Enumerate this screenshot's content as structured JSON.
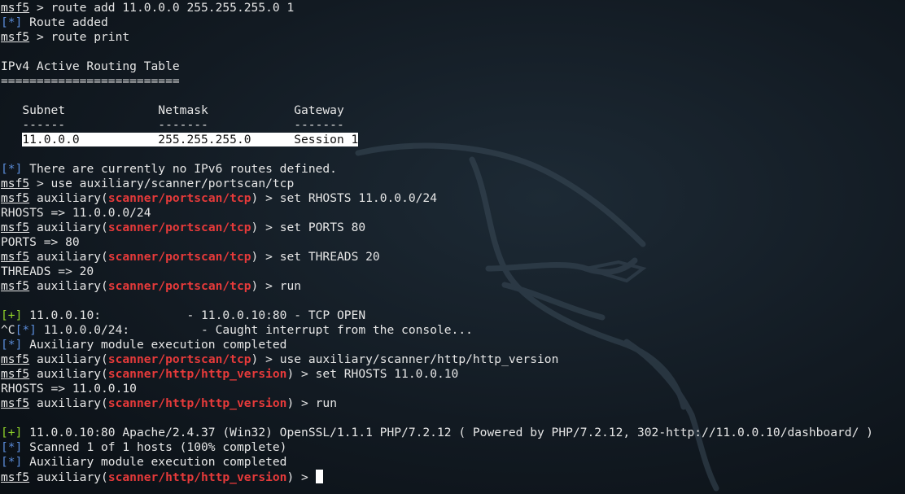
{
  "prompt": "msf5",
  "lines": [
    {
      "type": "cmd",
      "command": "route add 11.0.0.0 255.255.255.0 1"
    },
    {
      "type": "info",
      "marker": "[*]",
      "text": "Route added"
    },
    {
      "type": "cmd",
      "command": "route print"
    },
    {
      "type": "blank"
    },
    {
      "type": "text",
      "text": "IPv4 Active Routing Table"
    },
    {
      "type": "text",
      "text": "========================="
    },
    {
      "type": "blank"
    },
    {
      "type": "text",
      "text": "   Subnet             Netmask            Gateway"
    },
    {
      "type": "text",
      "text": "   ------             -------            -------"
    },
    {
      "type": "highlight",
      "prefix": "   ",
      "text": "11.0.0.0           255.255.255.0      Session 1"
    },
    {
      "type": "blank"
    },
    {
      "type": "info",
      "marker": "[*]",
      "text": "There are currently no IPv6 routes defined."
    },
    {
      "type": "cmd",
      "command": "use auxiliary/scanner/portscan/tcp"
    },
    {
      "type": "cmd",
      "module": "scanner/portscan/tcp",
      "command": "set RHOSTS 11.0.0.0/24"
    },
    {
      "type": "text",
      "text": "RHOSTS => 11.0.0.0/24"
    },
    {
      "type": "cmd",
      "module": "scanner/portscan/tcp",
      "command": "set PORTS 80"
    },
    {
      "type": "text",
      "text": "PORTS => 80"
    },
    {
      "type": "cmd",
      "module": "scanner/portscan/tcp",
      "command": "set THREADS 20"
    },
    {
      "type": "text",
      "text": "THREADS => 20"
    },
    {
      "type": "cmd",
      "module": "scanner/portscan/tcp",
      "command": "run"
    },
    {
      "type": "blank"
    },
    {
      "type": "good",
      "marker": "[+]",
      "text": "11.0.0.10:            - 11.0.0.10:80 - TCP OPEN"
    },
    {
      "type": "info",
      "prefix": "^C",
      "marker": "[*]",
      "text": "11.0.0.0/24:          - Caught interrupt from the console..."
    },
    {
      "type": "info",
      "marker": "[*]",
      "text": "Auxiliary module execution completed"
    },
    {
      "type": "cmd",
      "module": "scanner/portscan/tcp",
      "command": "use auxiliary/scanner/http/http_version"
    },
    {
      "type": "cmd",
      "module": "scanner/http/http_version",
      "command": "set RHOSTS 11.0.0.10"
    },
    {
      "type": "text",
      "text": "RHOSTS => 11.0.0.10"
    },
    {
      "type": "cmd",
      "module": "scanner/http/http_version",
      "command": "run"
    },
    {
      "type": "blank"
    },
    {
      "type": "good",
      "marker": "[+]",
      "text": "11.0.0.10:80 Apache/2.4.37 (Win32) OpenSSL/1.1.1 PHP/7.2.12 ( Powered by PHP/7.2.12, 302-http://11.0.0.10/dashboard/ )"
    },
    {
      "type": "info",
      "marker": "[*]",
      "text": "Scanned 1 of 1 hosts (100% complete)"
    },
    {
      "type": "info",
      "marker": "[*]",
      "text": "Auxiliary module execution completed"
    },
    {
      "type": "cmd",
      "module": "scanner/http/http_version",
      "command": "",
      "cursor": true
    }
  ],
  "colors": {
    "background": "#121a22",
    "text": "#e6e6e6",
    "module": "#e63a3a",
    "info_marker": "#5a8bd8",
    "good_marker": "#8fd22a",
    "highlight_bg": "#ffffff"
  },
  "background_icon": "kali-dragon-icon"
}
